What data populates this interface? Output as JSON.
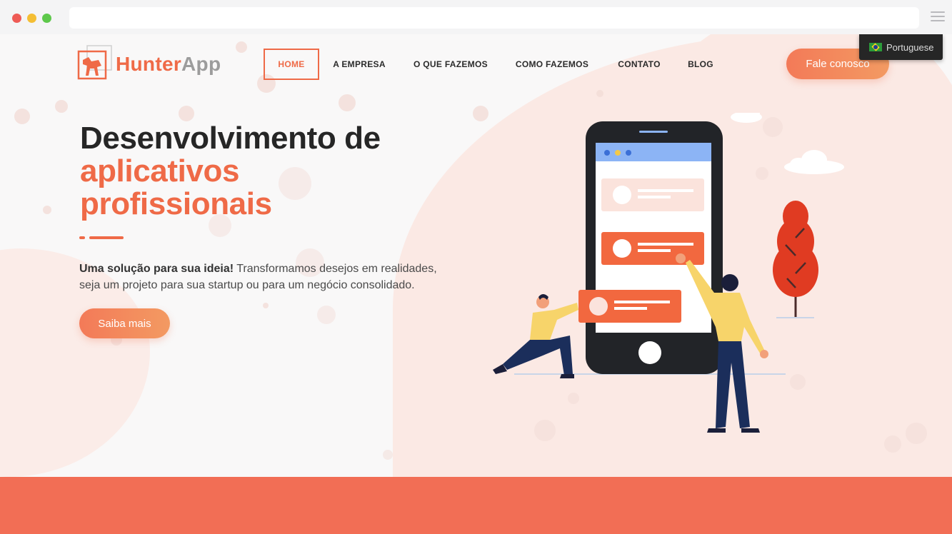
{
  "browser": {
    "url": ""
  },
  "header": {
    "logo": {
      "brand": "Hunter",
      "brand_suffix": "App"
    },
    "nav": [
      {
        "label": "HOME",
        "active": true
      },
      {
        "label": "A EMPRESA",
        "active": false
      },
      {
        "label": "O QUE FAZEMOS",
        "active": false
      },
      {
        "label": "COMO FAZEMOS",
        "active": false
      },
      {
        "label": "CONTATO",
        "active": false
      },
      {
        "label": "BLOG",
        "active": false
      }
    ],
    "cta_label": "Fale conosco"
  },
  "language_selector": {
    "label": "Portuguese",
    "flag": "brazil-flag-icon"
  },
  "hero": {
    "title_line1": "Desenvolvimento de",
    "title_line2": "aplicativos",
    "title_line3": "profissionais",
    "lead_bold": "Uma solução para sua ideia!",
    "lead_rest": " Transformamos desejos em realidades,",
    "lead_line2": "seja um projeto para sua startup ou para um negócio consolidado.",
    "button_label": "Saiba mais"
  },
  "colors": {
    "accent": "#ef6a47",
    "dark_text": "#262626",
    "band": "#f26e55"
  }
}
